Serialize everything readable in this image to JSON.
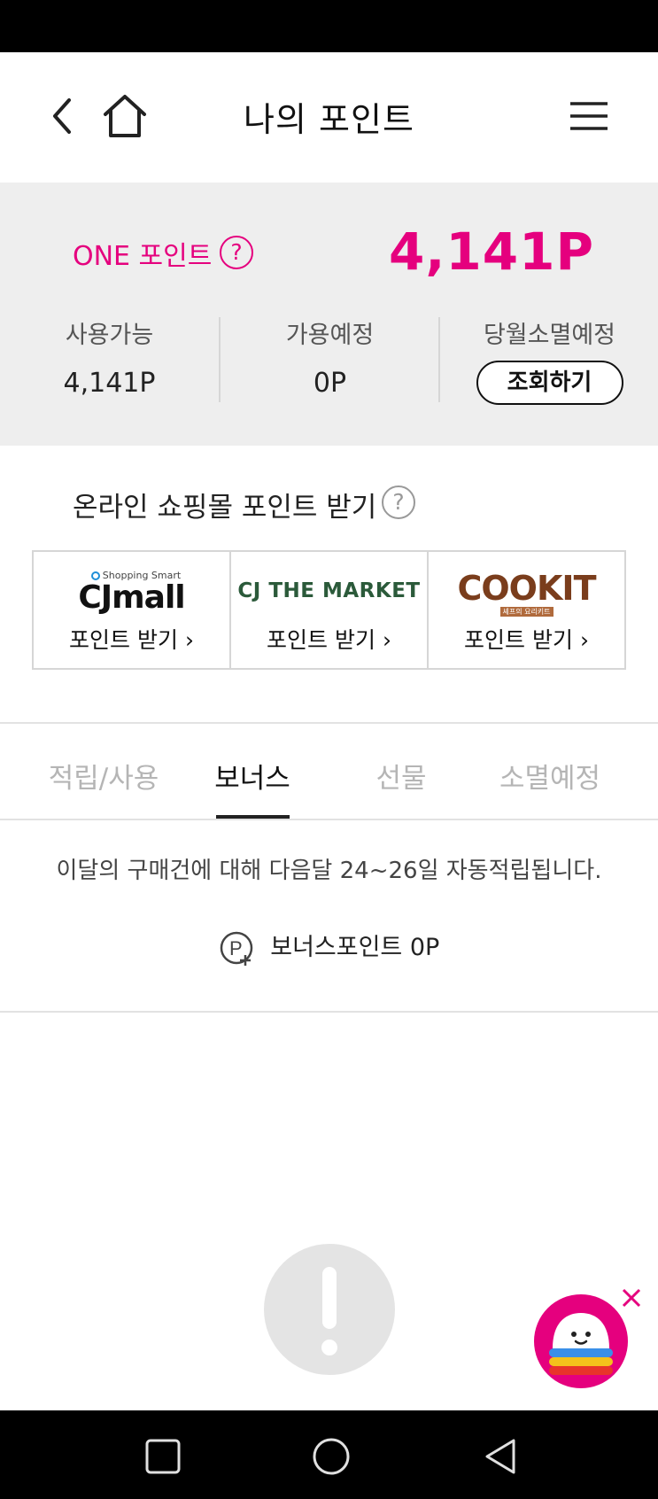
{
  "header": {
    "title": "나의 포인트"
  },
  "points": {
    "one_label": "ONE 포인트",
    "help_symbol": "?",
    "total": "4,141P",
    "available_label": "사용가능",
    "available_value": "4,141P",
    "pending_label": "가용예정",
    "pending_value": "0P",
    "expiring_label": "당월소멸예정",
    "expiring_button": "조회하기"
  },
  "online": {
    "title": "온라인 쇼핑몰 포인트 받기",
    "help_symbol": "?",
    "malls": [
      {
        "logo_small": "Shopping Smart",
        "logo": "CJmall",
        "action": "포인트 받기 ›"
      },
      {
        "logo": "CJ THE MARKET",
        "action": "포인트 받기 ›"
      },
      {
        "logo": "COOKIT",
        "logo_small": "셰프의 요리키트",
        "action": "포인트 받기 ›"
      }
    ]
  },
  "tabs": [
    {
      "label": "적립/사용",
      "active": false
    },
    {
      "label": "보너스",
      "active": true
    },
    {
      "label": "선물",
      "active": false
    },
    {
      "label": "소멸예정",
      "active": false
    }
  ],
  "bonus": {
    "notice": "이달의 구매건에 대해 다음달 24~26일 자동적립됩니다.",
    "label": "보너스포인트",
    "value": "0P"
  },
  "colors": {
    "accent": "#e5007e",
    "panel_bg": "#eeeeee",
    "inactive_tab": "#b5b5b5"
  },
  "icons": {
    "back": "chevron-left-icon",
    "home": "home-icon",
    "menu": "hamburger-menu-icon",
    "help": "question-circle-icon",
    "bonus": "point-plus-icon",
    "empty": "exclamation-circle-icon",
    "chatbot": "chatbot-mascot-icon",
    "close": "close-icon"
  }
}
